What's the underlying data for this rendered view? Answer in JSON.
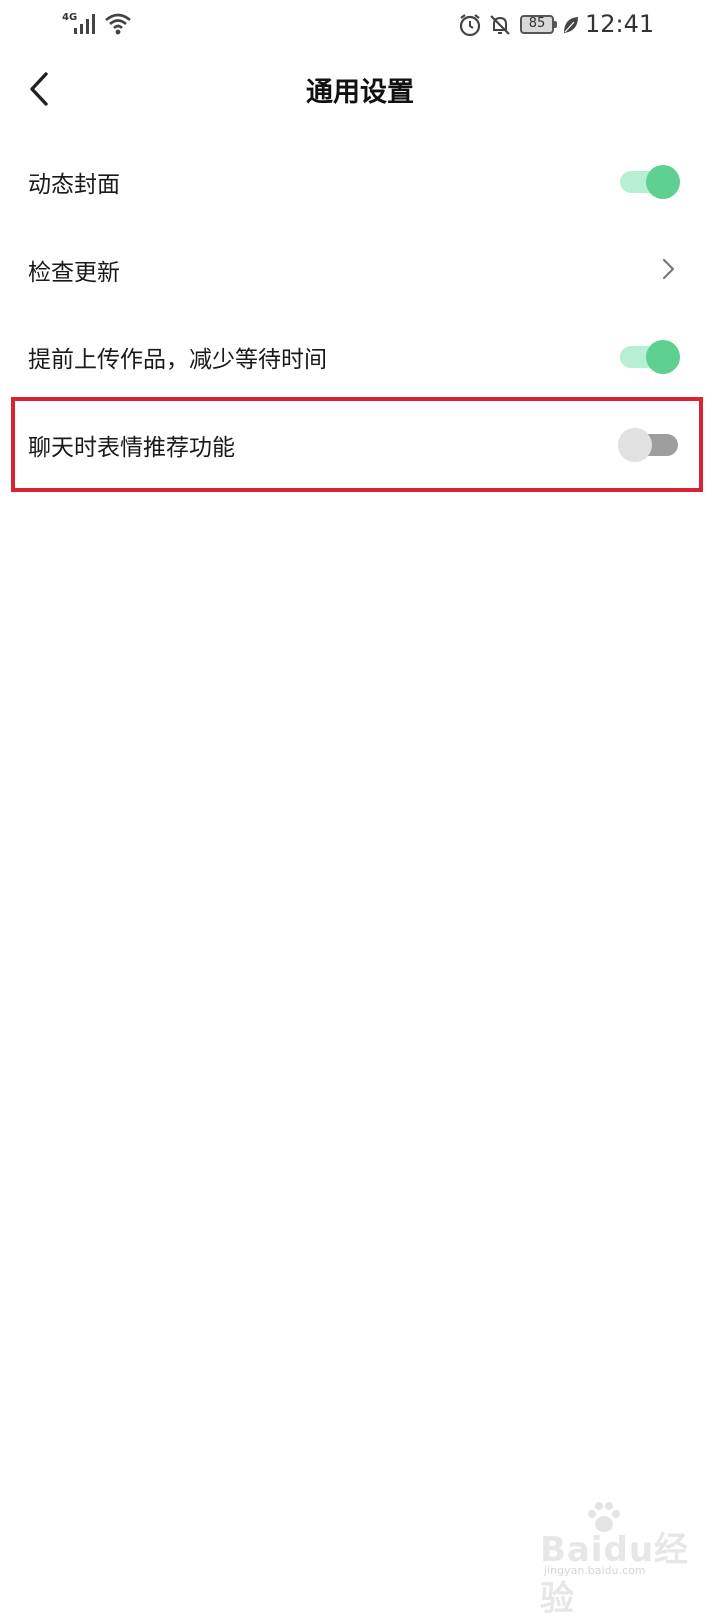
{
  "status_bar": {
    "network": "4G",
    "battery": "85",
    "time": "12:41",
    "icons": [
      "signal-icon",
      "wifi-icon",
      "alarm-icon",
      "notifications-off-icon",
      "battery-icon",
      "leaf-icon"
    ]
  },
  "header": {
    "title": "通用设置",
    "back_icon": "back-arrow-icon"
  },
  "settings": [
    {
      "label": "动态封面",
      "control": "toggle",
      "state": "on"
    },
    {
      "label": "检查更新",
      "control": "chevron"
    },
    {
      "label": "提前上传作品，减少等待时间",
      "control": "toggle",
      "state": "on"
    },
    {
      "label": "聊天时表情推荐功能",
      "control": "toggle",
      "state": "off",
      "highlighted": true
    }
  ],
  "colors": {
    "toggle_on_thumb": "#5ed08f",
    "toggle_on_track": "#b7efd2",
    "toggle_off_thumb": "#e1e1e1",
    "toggle_off_track": "#9e9e9e",
    "highlight": "#d9232e"
  },
  "watermark": {
    "brand": "Baidu经验",
    "url": "jingyan.baidu.com"
  }
}
